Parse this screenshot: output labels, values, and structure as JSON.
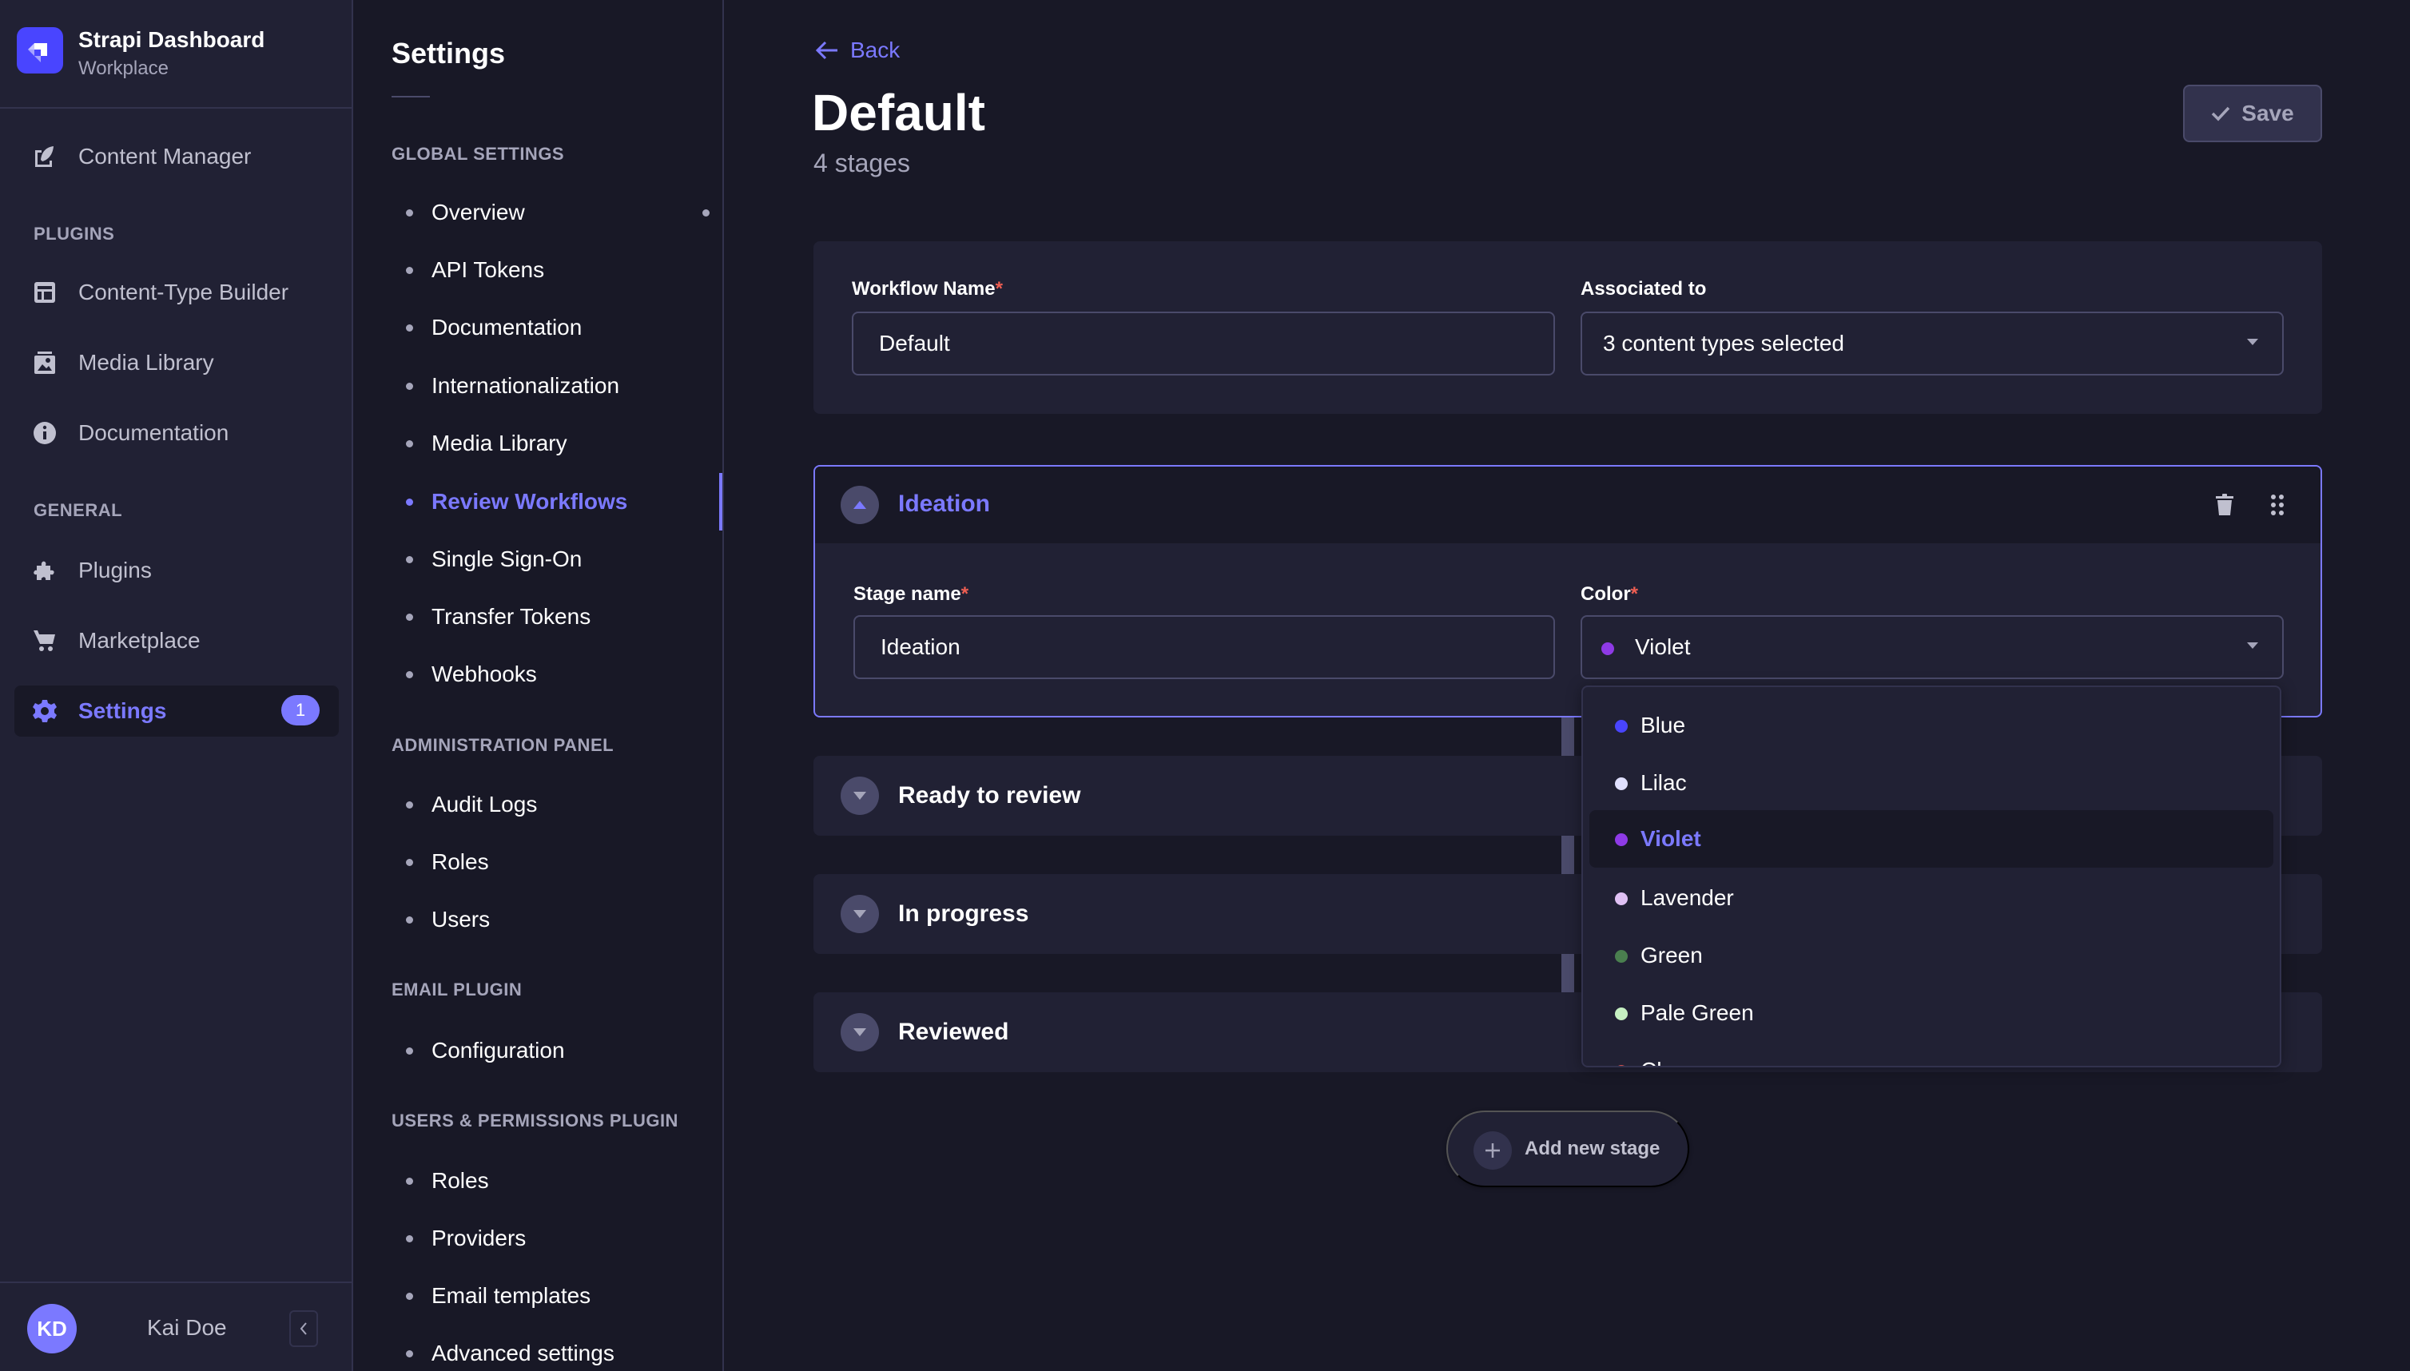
{
  "brand": {
    "title": "Strapi Dashboard",
    "subtitle": "Workplace",
    "logo_color": "#4945ff"
  },
  "main_nav": {
    "items": [
      {
        "label": "Content Manager",
        "icon": "feather-icon"
      },
      {
        "label": "Content-Type Builder",
        "icon": "layout-icon"
      },
      {
        "label": "Media Library",
        "icon": "image-icon"
      },
      {
        "label": "Documentation",
        "icon": "info-icon"
      },
      {
        "label": "Plugins",
        "icon": "puzzle-icon"
      },
      {
        "label": "Marketplace",
        "icon": "cart-icon"
      },
      {
        "label": "Settings",
        "icon": "gear-icon",
        "badge": "1",
        "active": true
      }
    ],
    "sections": {
      "plugins": "PLUGINS",
      "general": "GENERAL"
    }
  },
  "user": {
    "initials": "KD",
    "name": "Kai Doe",
    "collapse_icon": "chevron-left-icon"
  },
  "settings_nav": {
    "title": "Settings",
    "sections": [
      {
        "title": "GLOBAL SETTINGS",
        "items": [
          "Overview",
          "API Tokens",
          "Documentation",
          "Internationalization",
          "Media Library",
          "Review Workflows",
          "Single Sign-On",
          "Transfer Tokens",
          "Webhooks"
        ]
      },
      {
        "title": "ADMINISTRATION PANEL",
        "items": [
          "Audit Logs",
          "Roles",
          "Users"
        ]
      },
      {
        "title": "EMAIL PLUGIN",
        "items": [
          "Configuration"
        ]
      },
      {
        "title": "USERS & PERMISSIONS PLUGIN",
        "items": [
          "Roles",
          "Providers",
          "Email templates",
          "Advanced settings"
        ]
      }
    ],
    "active_item": "Review Workflows"
  },
  "header": {
    "back_label": "Back",
    "title": "Default",
    "subtitle": "4 stages",
    "save_label": "Save"
  },
  "workflow": {
    "name_label": "Workflow Name",
    "name_value": "Default",
    "assoc_label": "Associated to",
    "assoc_value": "3 content types selected",
    "required_mark": "*"
  },
  "stages": [
    {
      "name": "Ideation",
      "expanded": true,
      "color": "Violet"
    },
    {
      "name": "Ready to review",
      "expanded": false
    },
    {
      "name": "In progress",
      "expanded": false
    },
    {
      "name": "Reviewed",
      "expanded": false
    }
  ],
  "stage_form": {
    "name_label": "Stage name",
    "name_value": "Ideation",
    "color_label": "Color",
    "color_value": "Violet",
    "color_value_hex": "#8e3ae6"
  },
  "color_options": [
    {
      "label": "Blue",
      "hex": "#4945ff"
    },
    {
      "label": "Lilac",
      "hex": "#e0e0ff"
    },
    {
      "label": "Violet",
      "hex": "#8e3ae6",
      "selected": true
    },
    {
      "label": "Lavender",
      "hex": "#e0c1f4"
    },
    {
      "label": "Green",
      "hex": "#4a7f4f"
    },
    {
      "label": "Pale Green",
      "hex": "#c6f0c2"
    },
    {
      "label": "Cherry",
      "hex": "#d9534f"
    }
  ],
  "add_stage_label": "Add new stage",
  "colors": {
    "accent": "#7b79ff",
    "background": "#181826",
    "surface": "#212134",
    "required": "#ee5e52"
  }
}
